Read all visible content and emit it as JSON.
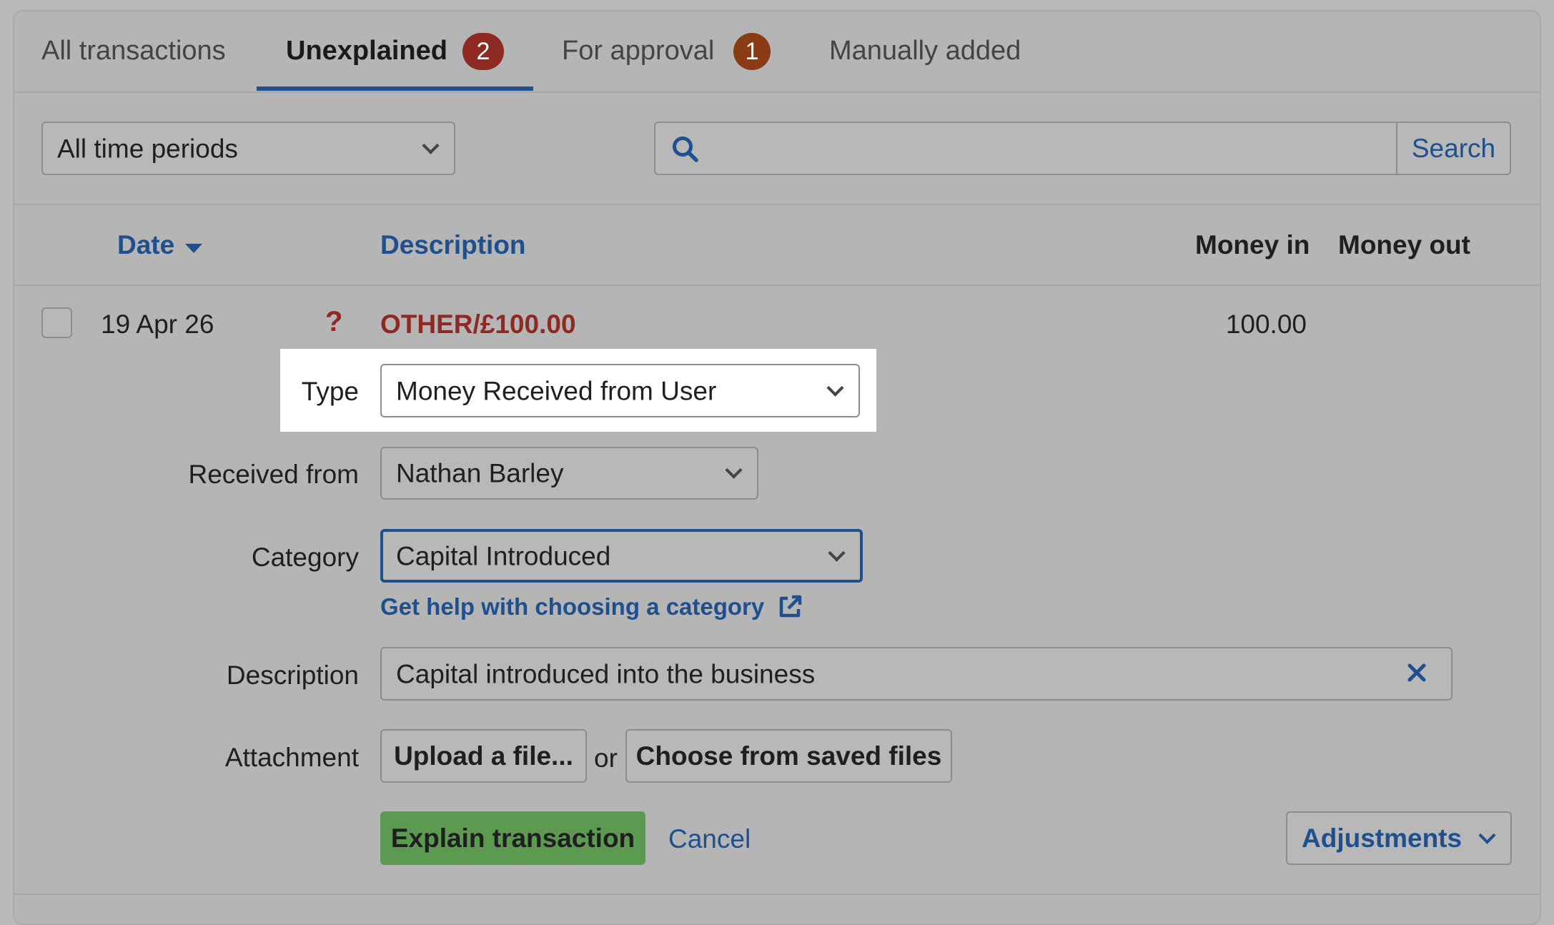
{
  "tabs": [
    {
      "label": "All transactions"
    },
    {
      "label": "Unexplained",
      "badge": "2"
    },
    {
      "label": "For approval",
      "badge": "1"
    },
    {
      "label": "Manually added"
    }
  ],
  "filters": {
    "period": "All time periods",
    "search_button": "Search"
  },
  "table": {
    "headers": {
      "date": "Date",
      "description": "Description",
      "money_in": "Money in",
      "money_out": "Money out"
    },
    "row": {
      "date": "19 Apr 26",
      "status_icon_text": "?",
      "description": "OTHER/£100.00",
      "money_in": "100.00",
      "money_out": ""
    }
  },
  "form": {
    "type_label": "Type",
    "type_value": "Money Received from User",
    "received_from_label": "Received from",
    "received_from_value": "Nathan Barley",
    "category_label": "Category",
    "category_value": "Capital Introduced",
    "category_help": "Get help with choosing a category",
    "description_label": "Description",
    "description_value": "Capital introduced into the business",
    "attachment_label": "Attachment",
    "upload_button": "Upload a file...",
    "or_text": "or",
    "saved_files_button": "Choose from saved files",
    "explain_button": "Explain transaction",
    "cancel_link": "Cancel",
    "adjustments_button": "Adjustments"
  },
  "colors": {
    "accent": "#1e4f8f",
    "unexplained_badge": "#8e2a23",
    "approval_badge": "#8a3c14",
    "negative_text": "#8e2a23",
    "primary_button": "#5c9a52"
  }
}
